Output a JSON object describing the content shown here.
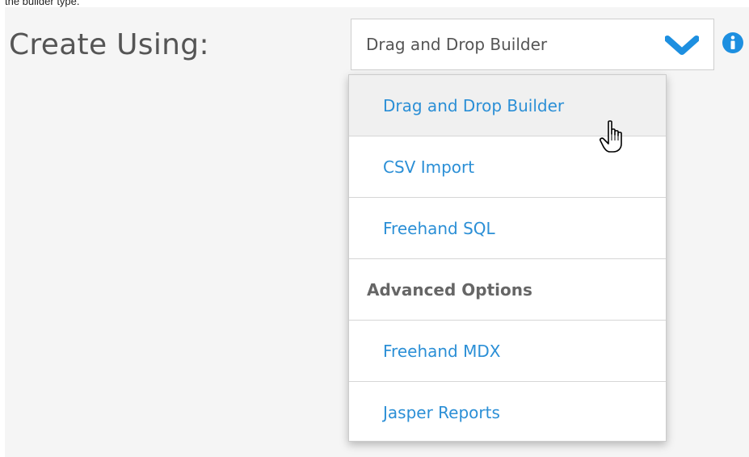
{
  "caption": "the builder type.",
  "form": {
    "label": "Create Using:",
    "selected_value": "Drag and Drop Builder"
  },
  "icons": {
    "chevron": "chevron-down-icon",
    "info": "info-icon",
    "cursor": "hand-pointer-icon"
  },
  "colors": {
    "accent": "#1d8fe0",
    "link": "#2b8fd6",
    "label": "#555555"
  },
  "dropdown": {
    "options": [
      {
        "label": "Drag and Drop Builder",
        "type": "option"
      },
      {
        "label": "CSV Import",
        "type": "option"
      },
      {
        "label": "Freehand SQL",
        "type": "option"
      },
      {
        "label": "Advanced Options",
        "type": "group"
      },
      {
        "label": "Freehand MDX",
        "type": "option"
      },
      {
        "label": "Jasper Reports",
        "type": "option"
      }
    ]
  }
}
